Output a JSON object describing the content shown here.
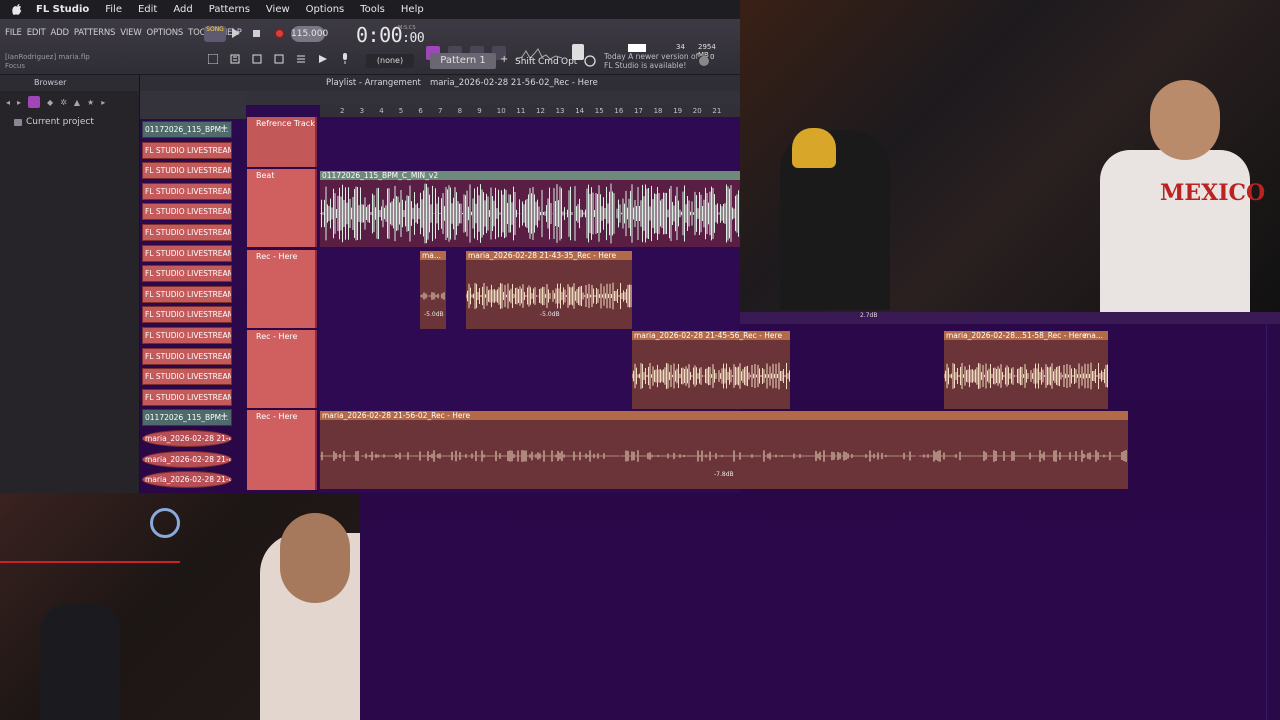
{
  "menubar": {
    "app_name": "FL Studio",
    "items": [
      "File",
      "Edit",
      "Add",
      "Patterns",
      "View",
      "Options",
      "Tools",
      "Help"
    ]
  },
  "toolbar": {
    "fl_menu": [
      "FILE",
      "EDIT",
      "ADD",
      "PATTERNS",
      "VIEW",
      "OPTIONS",
      "TOOLS",
      "HELP"
    ],
    "hint_line1": "[IanRodriguez] maria.flp",
    "hint_line2": "Focus",
    "song_mode": "SONG",
    "tempo": "115.000",
    "time": "0:00",
    "time_small": ":00",
    "time_unit": "M:S:CS",
    "pattern": "Pattern 1",
    "snap_select": "(none)",
    "mod_shift": "Shift",
    "mod_cmd": "Cmd",
    "mod_opt": "Opt",
    "news_line1": "Today  A newer version of",
    "news_line2": "FL Studio is available!",
    "cpu_num": "34",
    "mem": "2954 MB",
    "mem2": "0"
  },
  "browser": {
    "title": "Browser",
    "current_project": "Current project"
  },
  "tracklist": {
    "items": [
      {
        "label": "01172026_115_BPM...",
        "color": "green"
      },
      {
        "label": "FL STUDIO LIVESTREAM T...",
        "color": "red"
      },
      {
        "label": "FL STUDIO LIVESTREAM T...",
        "color": "red"
      },
      {
        "label": "FL STUDIO LIVESTREAM T...",
        "color": "red"
      },
      {
        "label": "FL STUDIO LIVESTREAM T...",
        "color": "red"
      },
      {
        "label": "FL STUDIO LIVESTREAM T...",
        "color": "red"
      },
      {
        "label": "FL STUDIO LIVESTREAM T...",
        "color": "red"
      },
      {
        "label": "FL STUDIO LIVESTREAM T...",
        "color": "red"
      },
      {
        "label": "FL STUDIO LIVESTREAM T...",
        "color": "red"
      },
      {
        "label": "FL STUDIO LIVESTREAM T...",
        "color": "red"
      },
      {
        "label": "FL STUDIO LIVESTREAM T...",
        "color": "red"
      },
      {
        "label": "FL STUDIO LIVESTREAM T...",
        "color": "red"
      },
      {
        "label": "FL STUDIO LIVESTREAM T...",
        "color": "red"
      },
      {
        "label": "FL STUDIO LIVESTREAM T...",
        "color": "red"
      },
      {
        "label": "01172026_115_BPM...",
        "color": "green"
      },
      {
        "label": "maria_2026-02-28 21-4...",
        "color": "rec"
      },
      {
        "label": "maria_2026-02-28 21-4...",
        "color": "rec"
      },
      {
        "label": "maria_2026-02-28 21-4...",
        "color": "rec"
      }
    ]
  },
  "playlist": {
    "title": "Playlist - Arrangement",
    "clip_name": "maria_2026-02-28 21-56-02_Rec - Here",
    "ruler": [
      "2",
      "3",
      "4",
      "5",
      "6",
      "7",
      "8",
      "9",
      "10",
      "11",
      "12",
      "13",
      "14",
      "15",
      "16",
      "17",
      "18",
      "19",
      "20",
      "21"
    ],
    "tracks": [
      {
        "name": "Refrence Track"
      },
      {
        "name": "Beat"
      },
      {
        "name": "Rec - Here"
      },
      {
        "name": "Rec - Here"
      },
      {
        "name": "Rec - Here"
      }
    ],
    "clips": {
      "beat": "01172026_115_BPM_C_MIN_v2",
      "rec1a": "ma...",
      "rec1b": "maria_2026-02-28 21-43-35_Rec - Here",
      "rec1a_db": "-5.0dB",
      "rec1b_db": "-5.0dB",
      "rec2a": "maria_2026-02-28 21-45-56_Rec - Here",
      "rec2b": "maria_2026-02-28...51-58_Rec - Here",
      "rec2b_tail": "ma...",
      "rec2_strip_db": "2.7dB",
      "rec3": "maria_2026-02-28 21-56-02_Rec - Here",
      "rec3_db": "-7.8dB"
    }
  },
  "colors": {
    "playlist_bg": "#2e0a52",
    "track_header": "#d06060",
    "beat_clip": "#5a1e44",
    "rec_clip": "#6b3438"
  }
}
